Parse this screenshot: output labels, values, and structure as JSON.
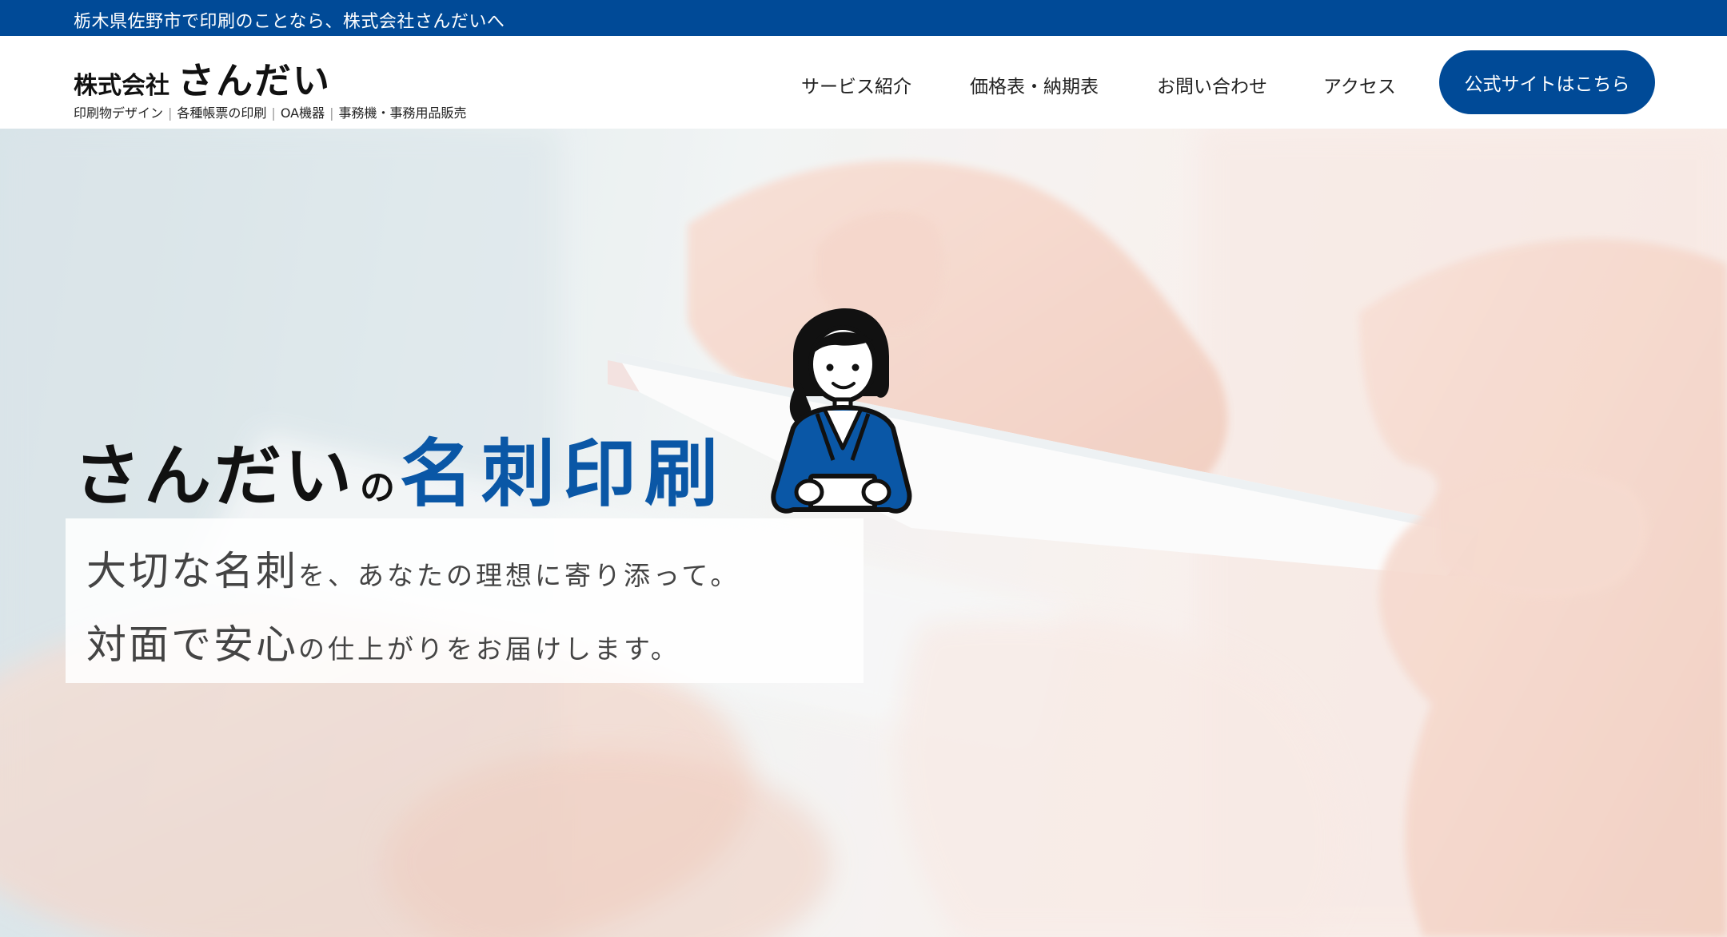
{
  "topbar": {
    "text": "栃木県佐野市で印刷のことなら、株式会社さんだいへ"
  },
  "header": {
    "logo_prefix": "株式会社",
    "logo_name": "さんだい",
    "tagline": [
      "印刷物デザイン",
      "各種帳票の印刷",
      "OA機器",
      "事務機・事務用品販売"
    ],
    "tagline_sep": "|"
  },
  "nav": {
    "items": [
      {
        "label": "サービス紹介"
      },
      {
        "label": "価格表・納期表"
      },
      {
        "label": "お問い合わせ"
      },
      {
        "label": "アクセス"
      }
    ],
    "cta_label": "公式サイトはこちら"
  },
  "hero": {
    "title_a": "さんだい",
    "title_no": "の",
    "title_b": "名刺印刷",
    "line1_big": "大切な名刺",
    "line1_small": "を、あなたの理想に寄り添って。",
    "line2_big": "対面で安心",
    "line2_small": "の仕上がりをお届けします。"
  },
  "colors": {
    "brand": "#004a97",
    "title_blue": "#0a57a6",
    "text_dark": "#111111"
  },
  "icons": {
    "mascot": "businesswoman-illustration"
  }
}
